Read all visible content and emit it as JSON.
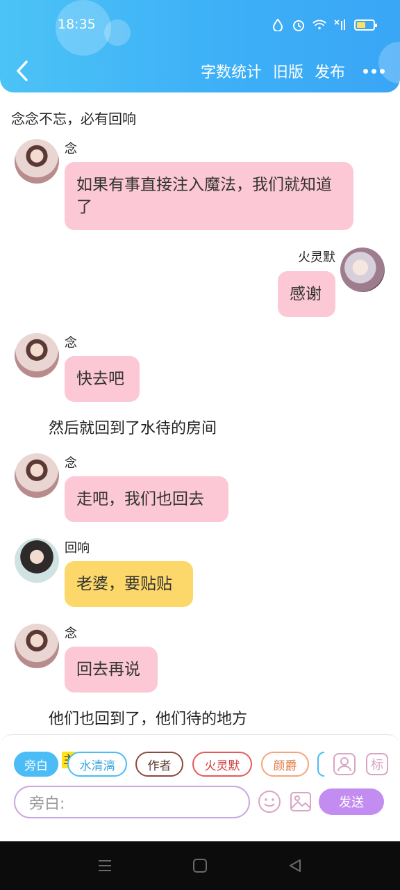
{
  "status": {
    "time": "18:35",
    "battery_level": 0.55
  },
  "header": {
    "actions": [
      "字数统计",
      "旧版",
      "发布"
    ],
    "colors": {
      "from": "#4cc3f6",
      "to": "#3aa6f6"
    }
  },
  "chat": {
    "intro": "念念不忘，必有回响",
    "messages": [
      {
        "name": "念",
        "text": "如果有事直接注入魔法，我们就知道了"
      },
      {
        "name": "火灵默",
        "text": "感谢"
      },
      {
        "name": "念",
        "text": "快去吧"
      },
      {
        "name": "念",
        "text": "走吧，我们也回去"
      },
      {
        "name": "回响",
        "text": "老婆，要贴贴"
      },
      {
        "name": "念",
        "text": "回去再说"
      }
    ],
    "narrations": [
      "然后就回到了水待的房间",
      "他们也回到了，他们待的地方"
    ]
  },
  "composer": {
    "chips": [
      "旁白",
      "水清漓",
      "作者",
      "火灵默",
      "颜爵"
    ],
    "main_tag": "主",
    "placeholder": "旁白:",
    "send_label": "发送",
    "side_buttons": [
      "标"
    ],
    "colors": {
      "chip_active": "#4bbcf5",
      "send": "#c38cf0",
      "bubble_pink": "#fcc8d5",
      "bubble_yellow": "#fcd86a"
    }
  }
}
